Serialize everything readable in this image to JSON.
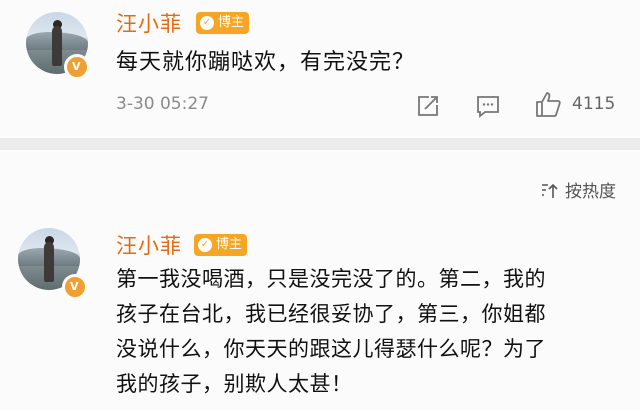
{
  "comment1": {
    "username": "汪小菲",
    "badge": "博主",
    "text": "每天就你蹦哒欢，有完没完？",
    "time": "3-30 05:27",
    "likes": "4115",
    "icons": [
      "repost-icon",
      "comment-icon",
      "like-icon"
    ]
  },
  "sort": {
    "label": "按热度",
    "icon": "sort-icon"
  },
  "comment2": {
    "username": "汪小菲",
    "badge": "博主",
    "lines": [
      "第一我没喝酒，只是没完没了的。第二，我的",
      "孩子在台北，我已经很妥协了，第三，你姐都",
      "没说什么，你天天的跟这儿得瑟什么呢？为了",
      "我的孩子，别欺人太甚！"
    ]
  },
  "colors": {
    "name": "#e56a10",
    "badge": "#f7a623",
    "verified": "#f0a030"
  }
}
